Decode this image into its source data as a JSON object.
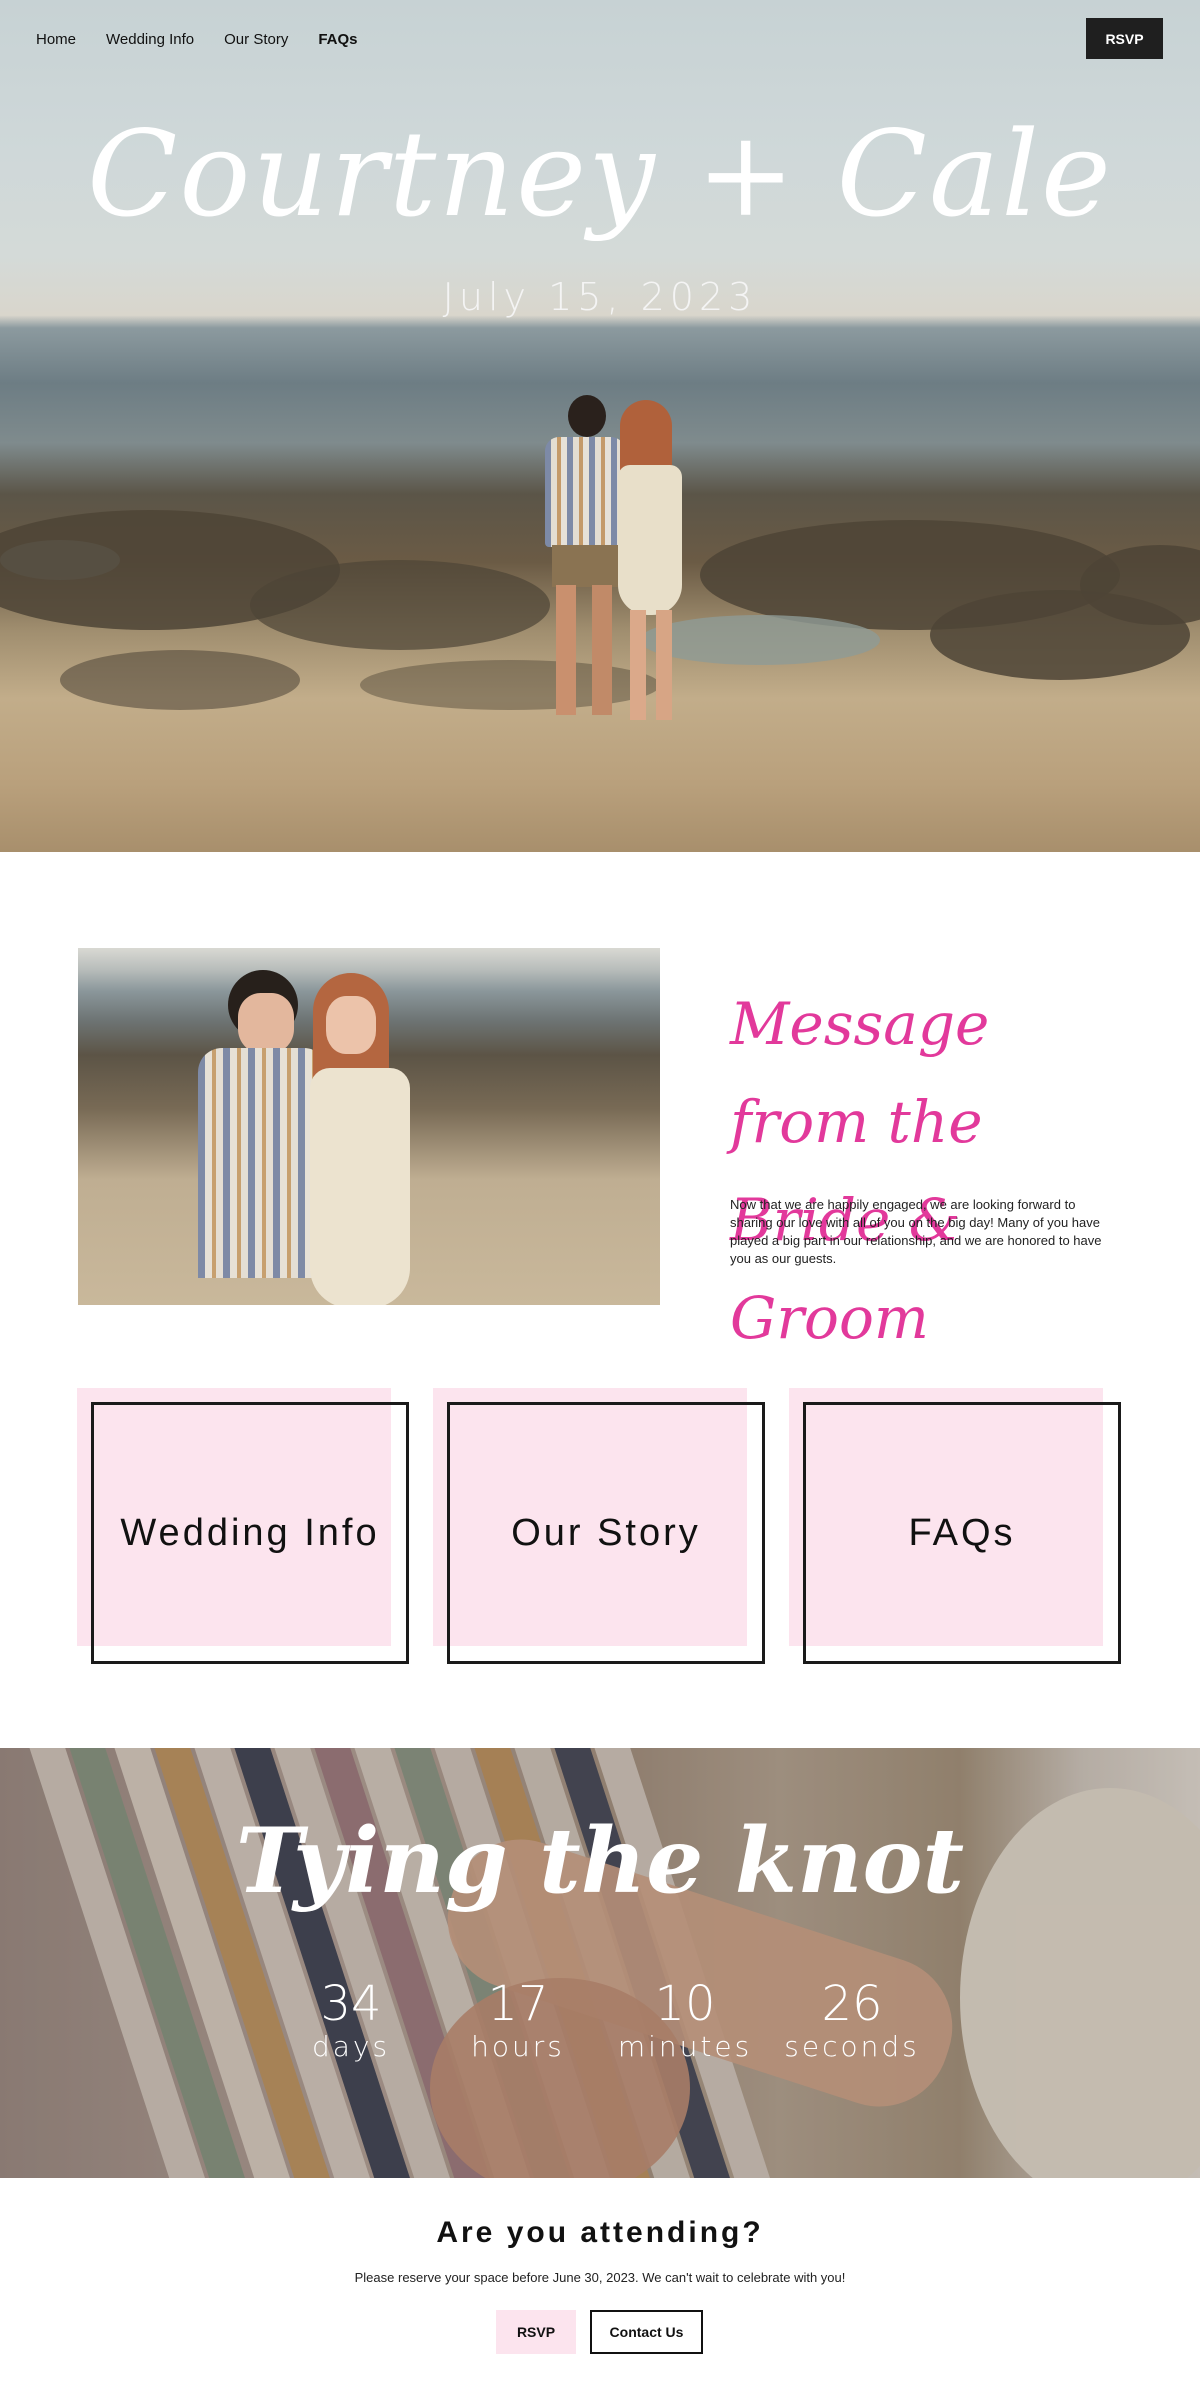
{
  "nav": {
    "items": [
      {
        "label": "Home"
      },
      {
        "label": "Wedding Info"
      },
      {
        "label": "Our Story"
      },
      {
        "label": "FAQs"
      }
    ],
    "rsvp_label": "RSVP"
  },
  "hero": {
    "title": "Courtney + Cale",
    "date": "July 15, 2023"
  },
  "message": {
    "title_line1": "Message from the",
    "title_line2": "Bride & Groom",
    "body": "Now that we are happily engaged, we are looking forward to sharing our love with all of you on the big day! Many of you have played a big part in our relationship, and we are honored to have you as our guests."
  },
  "cards": [
    {
      "label": "Wedding Info"
    },
    {
      "label": "Our Story"
    },
    {
      "label": "FAQs"
    }
  ],
  "countdown": {
    "title": "Tying the knot",
    "units": [
      {
        "value": "34",
        "label": "days"
      },
      {
        "value": "17",
        "label": "hours"
      },
      {
        "value": "10",
        "label": "minutes"
      },
      {
        "value": "26",
        "label": "seconds"
      }
    ]
  },
  "attending": {
    "title": "Are you attending?",
    "text": "Please reserve your space before June 30, 2023. We can't wait to celebrate with you!",
    "rsvp_label": "RSVP",
    "contact_label": "Contact Us"
  },
  "colors": {
    "accent_pink": "#e2399b",
    "card_pink": "#fce4ee",
    "dark_button": "#1f1f1f"
  }
}
